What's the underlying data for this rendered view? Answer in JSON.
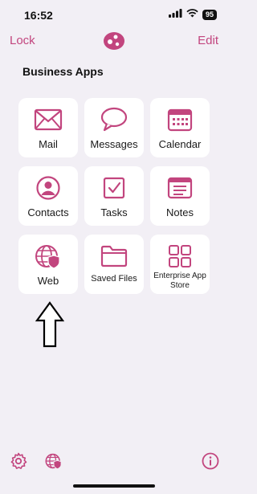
{
  "status": {
    "time": "16:52",
    "battery": "95"
  },
  "nav": {
    "lock_label": "Lock",
    "edit_label": "Edit"
  },
  "section": {
    "title": "Business Apps"
  },
  "apps": [
    {
      "label": "Mail",
      "icon": "mail-icon"
    },
    {
      "label": "Messages",
      "icon": "messages-icon"
    },
    {
      "label": "Calendar",
      "icon": "calendar-icon"
    },
    {
      "label": "Contacts",
      "icon": "contacts-icon"
    },
    {
      "label": "Tasks",
      "icon": "tasks-icon"
    },
    {
      "label": "Notes",
      "icon": "notes-icon"
    },
    {
      "label": "Web",
      "icon": "web-globe-shield-icon"
    },
    {
      "label": "Saved Files",
      "icon": "folder-icon"
    },
    {
      "label": "Enterprise App Store",
      "icon": "app-grid-icon"
    }
  ],
  "bottom": {
    "left_icons": [
      "settings-gear-icon",
      "web-globe-shield-icon"
    ],
    "right_icon": "info-icon"
  },
  "colors": {
    "accent": "#c2457e",
    "background": "#f2eff5",
    "tile": "#ffffff"
  }
}
